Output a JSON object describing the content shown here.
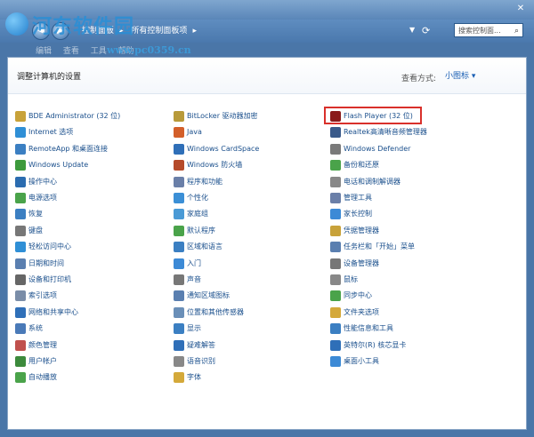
{
  "watermark": {
    "name": "河东软件园",
    "url": "www.pc0359.cn"
  },
  "window": {
    "close_label": "✕"
  },
  "address": {
    "crumbs": [
      "控制面板",
      "所有控制面板项"
    ],
    "search_placeholder": "搜索控制面...",
    "menu_partial": [
      "编辑",
      "查看",
      "工具",
      "帮助"
    ]
  },
  "header": {
    "title": "调整计算机的设置",
    "view_label": "查看方式:",
    "view_value": "小图标 ▾"
  },
  "colors": {
    "accent": "#1a5fb4",
    "highlight": "#d9302b"
  },
  "items": {
    "col1": [
      {
        "label": "BDE Administrator (32 位)",
        "icon": "bde-icon",
        "color": "#c8a23a"
      },
      {
        "label": "Internet 选项",
        "icon": "internet-options-icon",
        "color": "#2f8fd6"
      },
      {
        "label": "RemoteApp 和桌面连接",
        "icon": "remoteapp-icon",
        "color": "#3b7fc2"
      },
      {
        "label": "Windows Update",
        "icon": "windows-update-icon",
        "color": "#3c9a3c"
      },
      {
        "label": "操作中心",
        "icon": "action-center-icon",
        "color": "#2b6cb0"
      },
      {
        "label": "电源选项",
        "icon": "power-options-icon",
        "color": "#4aa34a"
      },
      {
        "label": "恢复",
        "icon": "recovery-icon",
        "color": "#3b7fc2"
      },
      {
        "label": "键盘",
        "icon": "keyboard-icon",
        "color": "#777777"
      },
      {
        "label": "轻松访问中心",
        "icon": "ease-of-access-icon",
        "color": "#2f8fd6"
      },
      {
        "label": "日期和时间",
        "icon": "date-time-icon",
        "color": "#5a7fb0"
      },
      {
        "label": "设备和打印机",
        "icon": "devices-printers-icon",
        "color": "#666666"
      },
      {
        "label": "索引选项",
        "icon": "indexing-icon",
        "color": "#7a8da8"
      },
      {
        "label": "网络和共享中心",
        "icon": "network-sharing-icon",
        "color": "#2f6fb8"
      },
      {
        "label": "系统",
        "icon": "system-icon",
        "color": "#4a7ab8"
      },
      {
        "label": "颜色管理",
        "icon": "color-management-icon",
        "color": "#c0504d"
      },
      {
        "label": "用户帐户",
        "icon": "user-accounts-icon",
        "color": "#3c8a3c"
      },
      {
        "label": "自动播放",
        "icon": "autoplay-icon",
        "color": "#4aa34a"
      }
    ],
    "col2": [
      {
        "label": "BitLocker 驱动器加密",
        "icon": "bitlocker-icon",
        "color": "#b89a3a"
      },
      {
        "label": "Java",
        "icon": "java-icon",
        "color": "#d35f2a"
      },
      {
        "label": "Windows CardSpace",
        "icon": "cardspace-icon",
        "color": "#2f6fb8"
      },
      {
        "label": "Windows 防火墙",
        "icon": "firewall-icon",
        "color": "#b54a2a"
      },
      {
        "label": "程序和功能",
        "icon": "programs-features-icon",
        "color": "#6a7fa8"
      },
      {
        "label": "个性化",
        "icon": "personalization-icon",
        "color": "#3b8fd6"
      },
      {
        "label": "家庭组",
        "icon": "homegroup-icon",
        "color": "#4a9ad6"
      },
      {
        "label": "默认程序",
        "icon": "default-programs-icon",
        "color": "#4aa34a"
      },
      {
        "label": "区域和语言",
        "icon": "region-language-icon",
        "color": "#3b7fc2"
      },
      {
        "label": "入门",
        "icon": "getting-started-icon",
        "color": "#3c8ad6"
      },
      {
        "label": "声音",
        "icon": "sound-icon",
        "color": "#777777"
      },
      {
        "label": "通知区域图标",
        "icon": "notification-icons-icon",
        "color": "#5a7fb0"
      },
      {
        "label": "位置和其他传感器",
        "icon": "location-sensors-icon",
        "color": "#6a8fb8"
      },
      {
        "label": "显示",
        "icon": "display-icon",
        "color": "#3b7fc2"
      },
      {
        "label": "疑难解答",
        "icon": "troubleshooting-icon",
        "color": "#2f6fb8"
      },
      {
        "label": "语音识别",
        "icon": "speech-recognition-icon",
        "color": "#888888"
      },
      {
        "label": "字体",
        "icon": "fonts-icon",
        "color": "#d4a93a"
      }
    ],
    "col3": [
      {
        "label": "Flash Player (32 位)",
        "icon": "flash-player-icon",
        "color": "#8a1a1a"
      },
      {
        "label": "Realtek高清晰音频管理器",
        "icon": "realtek-audio-icon",
        "color": "#3a5a8a"
      },
      {
        "label": "Windows Defender",
        "icon": "windows-defender-icon",
        "color": "#7a7a7a"
      },
      {
        "label": "备份和还原",
        "icon": "backup-restore-icon",
        "color": "#4aa34a"
      },
      {
        "label": "电话和调制解调器",
        "icon": "phone-modem-icon",
        "color": "#888888"
      },
      {
        "label": "管理工具",
        "icon": "admin-tools-icon",
        "color": "#6a7fa8"
      },
      {
        "label": "家长控制",
        "icon": "parental-controls-icon",
        "color": "#3c8ad6"
      },
      {
        "label": "凭据管理器",
        "icon": "credential-manager-icon",
        "color": "#c8a23a"
      },
      {
        "label": "任务栏和「开始」菜单",
        "icon": "taskbar-start-icon",
        "color": "#5a7fb0"
      },
      {
        "label": "设备管理器",
        "icon": "device-manager-icon",
        "color": "#777777"
      },
      {
        "label": "鼠标",
        "icon": "mouse-icon",
        "color": "#888888"
      },
      {
        "label": "同步中心",
        "icon": "sync-center-icon",
        "color": "#4aa34a"
      },
      {
        "label": "文件夹选项",
        "icon": "folder-options-icon",
        "color": "#d4a93a"
      },
      {
        "label": "性能信息和工具",
        "icon": "performance-icon",
        "color": "#3b7fc2"
      },
      {
        "label": "英特尔(R) 核芯显卡",
        "icon": "intel-graphics-icon",
        "color": "#2f6fb8"
      },
      {
        "label": "桌面小工具",
        "icon": "gadgets-icon",
        "color": "#3c8ad6"
      }
    ]
  }
}
